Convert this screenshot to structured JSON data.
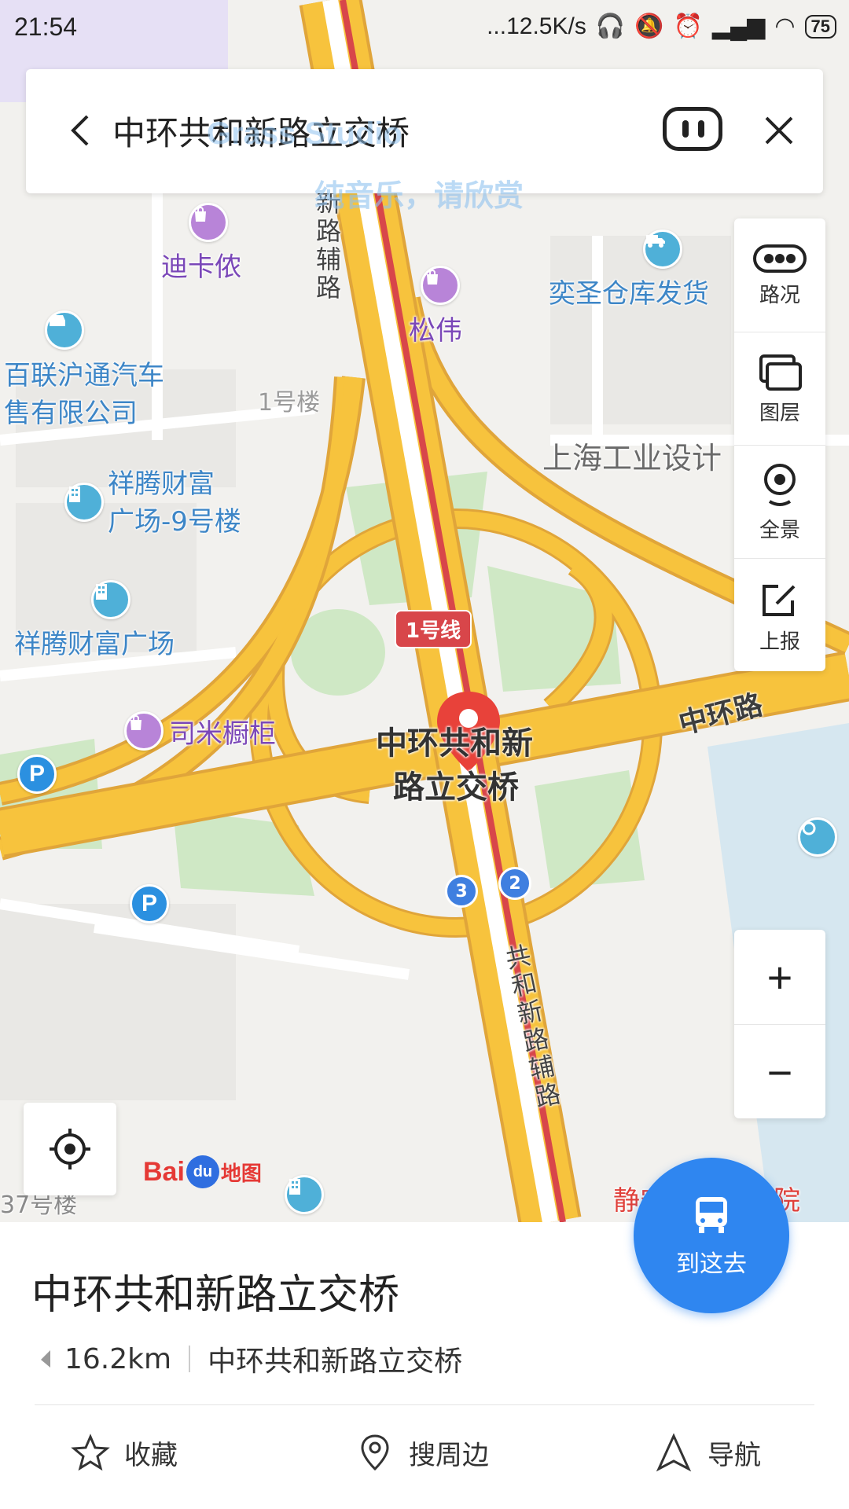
{
  "status_bar": {
    "time": "21:54",
    "speed": "...12.5K/s",
    "battery": "75"
  },
  "search": {
    "query": "中环共和新路立交桥",
    "watermark_line1": "Grass Studio",
    "watermark_line2": "纯音乐，请欣赏"
  },
  "tools": [
    {
      "label": "路况",
      "icon": "traffic-icon"
    },
    {
      "label": "图层",
      "icon": "layers-icon"
    },
    {
      "label": "全景",
      "icon": "panorama-icon"
    },
    {
      "label": "上报",
      "icon": "report-icon"
    }
  ],
  "zoom": {
    "in": "+",
    "out": "−"
  },
  "map": {
    "logo_text": "Bai",
    "logo_paw": "du",
    "logo_suffix": "地图",
    "pin_label_line1": "中环共和新",
    "pin_label_line2": "路立交桥",
    "metro_line": "1号线",
    "road_main": "中环路",
    "road_aux_north": "新路辅路",
    "road_aux_south": "共和新路辅路",
    "exit_2": "2",
    "exit_3": "3",
    "parking": "P",
    "pois": {
      "dikaxi": "迪卡侬",
      "songwei": "松伟",
      "yisheng": "奕圣仓库发货",
      "bailian_1": "百联沪通汽车",
      "bailian_2": "售有限公司",
      "building1": "1号楼",
      "shanghai_industry": "上海工业设计",
      "xiangteng9_1": "祥腾财富",
      "xiangteng9_2": "广场-9号楼",
      "xiangteng": "祥腾财富广场",
      "simi": "司米橱柜",
      "court": "静安区人民法院",
      "bldg37": "37号楼"
    }
  },
  "place": {
    "name": "中环共和新路立交桥",
    "distance": "16.2km",
    "address": "中环共和新路立交桥"
  },
  "go_here": "到这去",
  "actions": [
    {
      "label": "收藏",
      "icon": "star-icon"
    },
    {
      "label": "搜周边",
      "icon": "location-pin-icon"
    },
    {
      "label": "导航",
      "icon": "navigation-arrow-icon"
    }
  ],
  "colors": {
    "road": "#f7c33d",
    "road_edge": "#e0a53a",
    "metro": "#d8464a",
    "park": "#cfe8c5",
    "water": "#cfe3ef",
    "accent": "#2f86f0"
  }
}
